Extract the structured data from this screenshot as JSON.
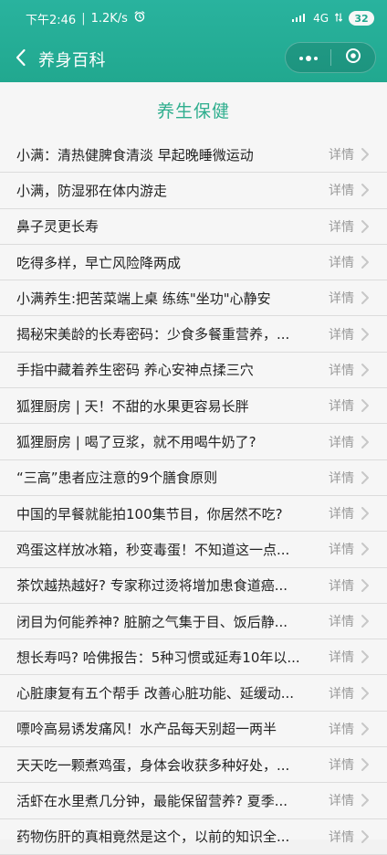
{
  "status_bar": {
    "time": "下午2:46",
    "network_speed": "1.2K/s",
    "alarm_icon": "alarm-icon",
    "signal_icon": "signal-icon",
    "network_type": "4G",
    "battery": "32"
  },
  "navbar": {
    "title": "养身百科",
    "back_icon": "chevron-left-icon",
    "more_icon": "more-icon",
    "close_icon": "target-close-icon"
  },
  "section": {
    "title": "养生保健"
  },
  "list": {
    "detail_label": "详情",
    "items": [
      "小满：清热健脾食清淡 早起晚睡微运动",
      "小满，防湿邪在体内游走",
      "鼻子灵更长寿",
      "吃得多样，早亡风险降两成",
      "小满养生:把苦菜端上桌 练练\"坐功\"心静安",
      "揭秘宋美龄的长寿密码：少食多餐重营养，...",
      "手指中藏着养生密码 养心安神点揉三穴",
      "狐狸厨房 | 天！不甜的水果更容易长胖",
      "狐狸厨房 | 喝了豆浆，就不用喝牛奶了?",
      "“三高”患者应注意的9个膳食原则",
      "中国的早餐就能拍100集节目，你居然不吃?",
      "鸡蛋这样放冰箱，秒变毒蛋！不知道这一点...",
      "茶饮越热越好? 专家称过烫将增加患食道癌...",
      "闭目为何能养神? 脏腑之气集于目、饭后静...",
      "想长寿吗? 哈佛报告：5种习惯或延寿10年以...",
      "心脏康复有五个帮手 改善心脏功能、延缓动...",
      "嘌呤高易诱发痛风！水产品每天别超一两半",
      "天天吃一颗煮鸡蛋，身体会收获多种好处，...",
      "活虾在水里煮几分钟，最能保留营养? 夏季...",
      "药物伤肝的真相竟然是这个，以前的知识全..."
    ]
  },
  "colors": {
    "header": "#21a88f",
    "accent": "#2fae8e",
    "text": "#222222",
    "muted": "#9a9a9a"
  }
}
